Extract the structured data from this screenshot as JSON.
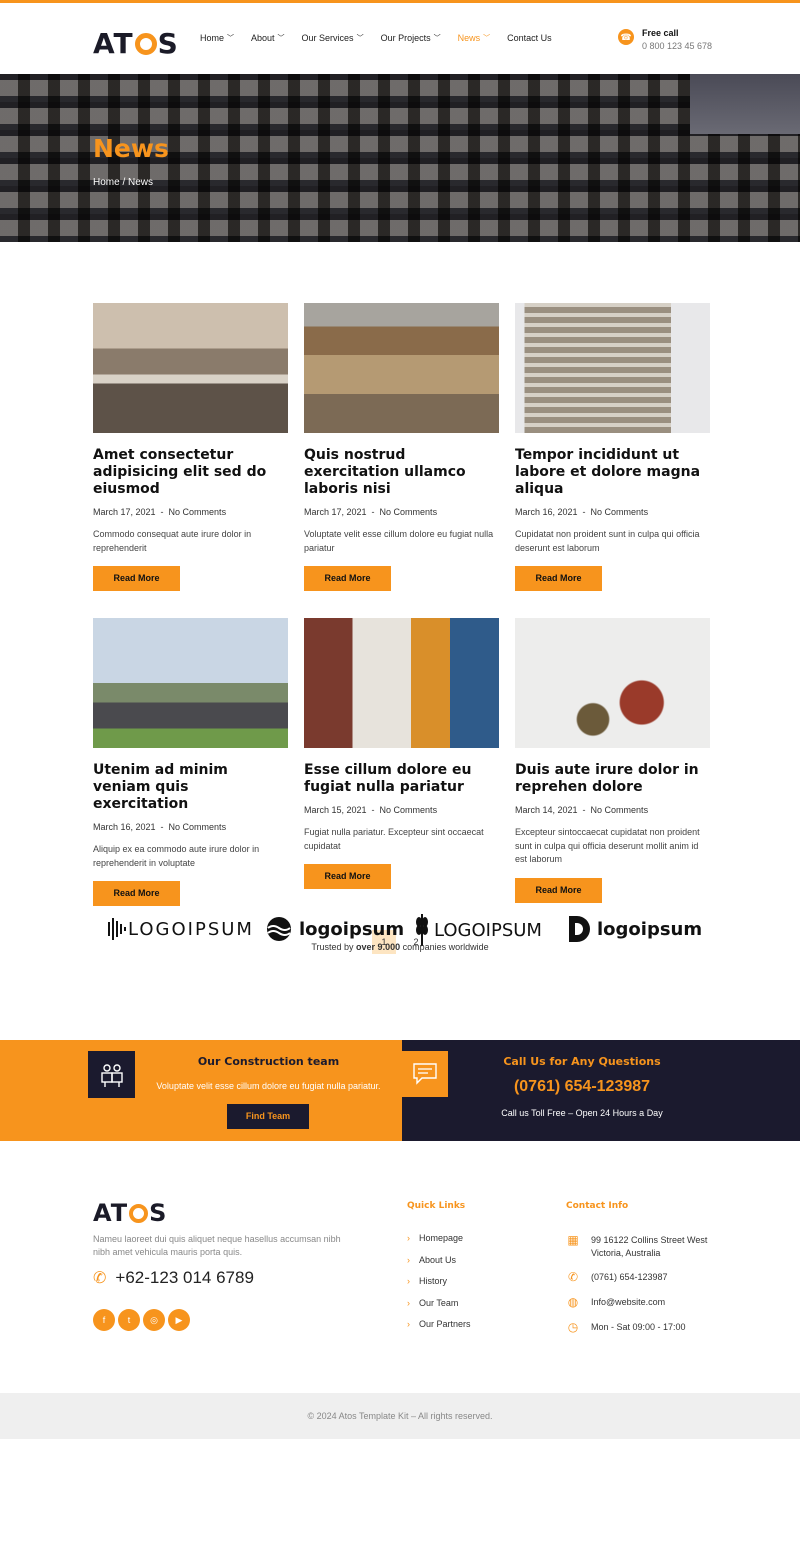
{
  "header": {
    "logo": {
      "pre": "AT",
      "post": "S"
    },
    "nav": [
      {
        "label": "Home",
        "chevron": true
      },
      {
        "label": "About",
        "chevron": true
      },
      {
        "label": "Our Services",
        "chevron": true
      },
      {
        "label": "Our Projects",
        "chevron": true
      },
      {
        "label": "News",
        "chevron": true,
        "active": true
      },
      {
        "label": "Contact Us",
        "chevron": false
      }
    ],
    "free_call_label": "Free call",
    "free_call_number": "0 800 123 45 678"
  },
  "hero": {
    "title": "News",
    "breadcrumb": "Home / News"
  },
  "posts": [
    {
      "title": "Amet consectetur adipisicing elit sed do eiusmod",
      "date": "March 17, 2021",
      "comments": "No Comments",
      "excerpt": "Commodo consequat aute irure dolor in reprehenderit",
      "button": "Read More"
    },
    {
      "title": "Quis nostrud exercitation ullamco laboris nisi",
      "date": "March 17, 2021",
      "comments": "No Comments",
      "excerpt": "Voluptate velit esse cillum dolore eu fugiat nulla pariatur",
      "button": "Read More"
    },
    {
      "title": "Tempor incididunt ut labore et dolore magna aliqua",
      "date": "March 16, 2021",
      "comments": "No Comments",
      "excerpt": "Cupidatat non proident sunt in culpa qui officia deserunt est laborum",
      "button": "Read More"
    },
    {
      "title": "Utenim ad minim veniam quis exercitation",
      "date": "March 16, 2021",
      "comments": "No Comments",
      "excerpt": "Aliquip ex ea commodo aute irure dolor in reprehenderit in voluptate",
      "button": "Read More"
    },
    {
      "title": "Esse cillum dolore eu fugiat nulla pariatur",
      "date": "March 15, 2021",
      "comments": "No Comments",
      "excerpt": "Fugiat nulla pariatur. Excepteur sint occaecat cupidatat",
      "button": "Read More"
    },
    {
      "title": "Duis aute irure dolor in reprehen dolore",
      "date": "March 14, 2021",
      "comments": "No Comments",
      "excerpt": "Excepteur sintoccaecat cupidatat non proident sunt in culpa qui officia deserunt mollit anim id est laborum",
      "button": "Read More"
    }
  ],
  "pagination": {
    "pages": [
      "1",
      "2"
    ],
    "current": "1"
  },
  "partners": {
    "logos": [
      "LOGOIPSUM",
      "logoipsum",
      "LOGOIPSUM",
      "logoipsum"
    ],
    "trusted_pre": "Trusted by",
    "trusted_bold": "over 9.000",
    "trusted_post": "companies worldwide"
  },
  "cta": {
    "team_title": "Our Construction team",
    "team_sub": "Voluptate velit esse cillum dolore eu fugiat nulla pariatur.",
    "team_button": "Find Team",
    "call_title": "Call Us for Any Questions",
    "call_number": "(0761) 654-123987",
    "call_sub": "Call us Toll Free – Open 24 Hours a Day"
  },
  "footer": {
    "logo": {
      "pre": "AT",
      "post": "S"
    },
    "description": "Nameu laoreet dui quis aliquet neque hasellus accumsan nibh nibh amet vehicula mauris porta quis.",
    "phone": "+62-123 014 6789",
    "social": [
      "facebook-icon",
      "twitter-icon",
      "instagram-icon",
      "youtube-icon"
    ],
    "quick_links_title": "Quick Links",
    "quick_links": [
      "Homepage",
      "About Us",
      "History",
      "Our Team",
      "Our Partners"
    ],
    "contact_title": "Contact Info",
    "contact": [
      {
        "icon": "map-icon",
        "text": "99 16122 Collins Street West Victoria, Australia"
      },
      {
        "icon": "phone-icon",
        "text": "(0761) 654-123987"
      },
      {
        "icon": "globe-icon",
        "text": "Info@website.com"
      },
      {
        "icon": "clock-icon",
        "text": "Mon - Sat 09:00 - 17:00"
      }
    ],
    "copyright": "© 2024 Atos Template Kit – All rights reserved."
  },
  "colors": {
    "accent": "#f7941d",
    "dark": "#1b1a2e"
  }
}
